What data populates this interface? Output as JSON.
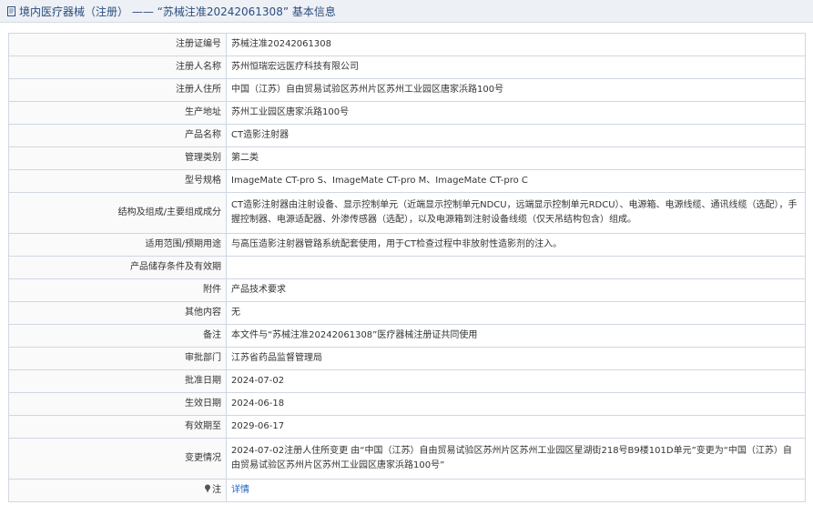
{
  "header": {
    "title": "境内医疗器械（注册） —— “苏械注准20242061308” 基本信息"
  },
  "rows": [
    {
      "label": "注册证编号",
      "value": "苏械注准20242061308"
    },
    {
      "label": "注册人名称",
      "value": "苏州恒瑞宏远医疗科技有限公司"
    },
    {
      "label": "注册人住所",
      "value": "中国（江苏）自由贸易试验区苏州片区苏州工业园区唐家浜路100号"
    },
    {
      "label": "生产地址",
      "value": "苏州工业园区唐家浜路100号"
    },
    {
      "label": "产品名称",
      "value": "CT造影注射器"
    },
    {
      "label": "管理类别",
      "value": "第二类"
    },
    {
      "label": "型号规格",
      "value": "ImageMate CT-pro S、ImageMate CT-pro M、ImageMate CT-pro C"
    },
    {
      "label": "结构及组成/主要组成成分",
      "value": "CT造影注射器由注射设备、显示控制单元（近端显示控制单元NDCU，远端显示控制单元RDCU）、电源箱、电源线缆、通讯线缆（选配），手握控制器、电源适配器、外渗传感器（选配），以及电源箱到注射设备线缆（仅天吊结构包含）组成。"
    },
    {
      "label": "适用范围/预期用途",
      "value": "与高压造影注射器管路系统配套使用，用于CT检查过程中非放射性造影剂的注入。"
    },
    {
      "label": "产品储存条件及有效期",
      "value": ""
    },
    {
      "label": "附件",
      "value": "产品技术要求"
    },
    {
      "label": "其他内容",
      "value": "无"
    },
    {
      "label": "备注",
      "value": "本文件与“苏械注准20242061308”医疗器械注册证共同使用"
    },
    {
      "label": "审批部门",
      "value": "江苏省药品监督管理局"
    },
    {
      "label": "批准日期",
      "value": "2024-07-02"
    },
    {
      "label": "生效日期",
      "value": "2024-06-18"
    },
    {
      "label": "有效期至",
      "value": "2029-06-17"
    },
    {
      "label": "变更情况",
      "value": "2024-07-02注册人住所变更 由“中国（江苏）自由贸易试验区苏州片区苏州工业园区星湖街218号B9楼101D单元”变更为“中国（江苏）自由贸易试验区苏州片区苏州工业园区唐家浜路100号”"
    }
  ],
  "note": {
    "label": "注",
    "link_text": "详情",
    "icon": "pin-icon"
  },
  "colors": {
    "title_text": "#2b4d7e",
    "link": "#1e62c4",
    "border": "#cfd7e3",
    "title_bg": "#edf0f5"
  }
}
